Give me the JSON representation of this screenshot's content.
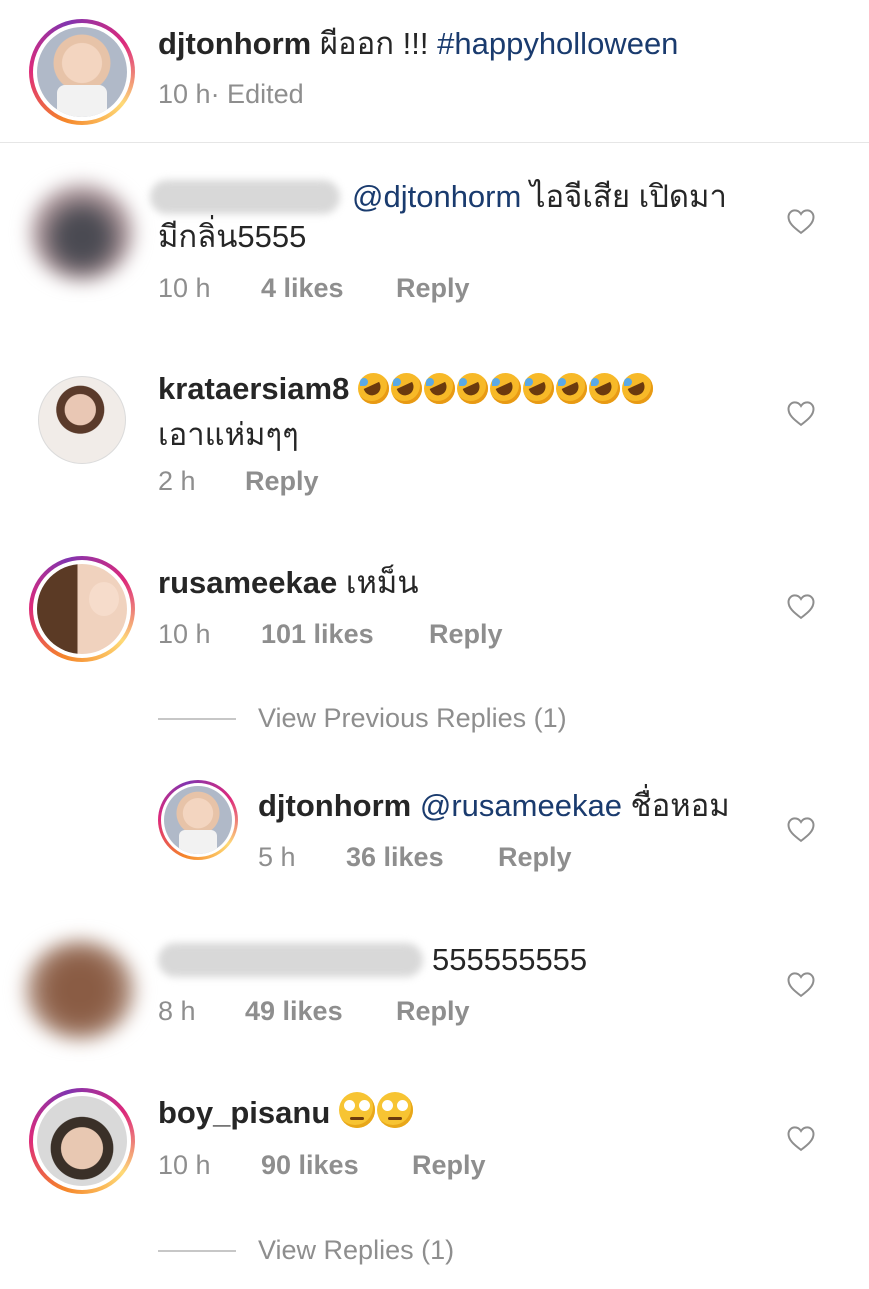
{
  "post": {
    "username": "djtonhorm",
    "caption": "ผีออก !!! ",
    "hashtag": "#happyholloween",
    "time": "10 h",
    "edited": " · Edited"
  },
  "comments": [
    {
      "username": "",
      "mention": "@djtonhorm",
      "text_line1": " ไอจีเสีย เปิดมา",
      "text_line2": "มีกลิ่น5555",
      "time": "10 h",
      "likes": "4 likes",
      "reply": "Reply"
    },
    {
      "username": "krataersiam8",
      "emojis": [
        "rolling-on-floor-laughing",
        "rolling-on-floor-laughing",
        "rolling-on-floor-laughing",
        "rolling-on-floor-laughing",
        "rolling-on-floor-laughing",
        "rolling-on-floor-laughing",
        "rolling-on-floor-laughing",
        "rolling-on-floor-laughing",
        "rolling-on-floor-laughing"
      ],
      "text_line2": "เอาแห่มๆๆ",
      "time": "2 h",
      "reply": "Reply"
    },
    {
      "username": "rusameekae",
      "text": " เหม็น",
      "time": "10 h",
      "likes": "101 likes",
      "reply": "Reply",
      "view_replies": "View Previous Replies (1)"
    },
    {
      "username": "djtonhorm",
      "mention": "@rusameekae",
      "text": " ชื่อหอม",
      "time": "5 h",
      "likes": "36 likes",
      "reply": "Reply"
    },
    {
      "username": "",
      "text": "555555555",
      "time": "8 h",
      "likes": "49 likes",
      "reply": "Reply"
    },
    {
      "username": "boy_pisanu",
      "emojis": [
        "face-with-rolling-eyes",
        "face-with-rolling-eyes"
      ],
      "time": "10 h",
      "likes": "90 likes",
      "reply": "Reply",
      "view_replies": "View Replies (1)"
    }
  ],
  "icons": {
    "like": "heart-outline-icon"
  },
  "colors": {
    "text": "#262626",
    "meta": "#8e8e8e",
    "mention": "#1a3b6e",
    "story_ring": "#dd2a7b"
  }
}
